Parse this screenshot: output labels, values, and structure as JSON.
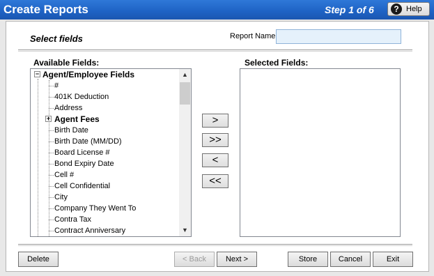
{
  "window": {
    "title": "Create Reports",
    "step": "Step 1 of 6",
    "help_label": "Help",
    "help_icon": "?"
  },
  "section": {
    "title": "Select fields",
    "report_name_label": "Report Name:",
    "report_name_value": ""
  },
  "available": {
    "label": "Available Fields:",
    "items": [
      {
        "text": "Agent/Employee Fields",
        "type": "group",
        "expanded": true
      },
      {
        "text": "#",
        "type": "leaf"
      },
      {
        "text": "401K Deduction",
        "type": "leaf"
      },
      {
        "text": "Address",
        "type": "leaf"
      },
      {
        "text": "Agent Fees",
        "type": "group",
        "expanded": false
      },
      {
        "text": "Birth Date",
        "type": "leaf"
      },
      {
        "text": "Birth Date (MM/DD)",
        "type": "leaf"
      },
      {
        "text": "Board License #",
        "type": "leaf"
      },
      {
        "text": "Bond Expiry Date",
        "type": "leaf"
      },
      {
        "text": "Cell #",
        "type": "leaf"
      },
      {
        "text": "Cell Confidential",
        "type": "leaf"
      },
      {
        "text": "City",
        "type": "leaf"
      },
      {
        "text": "Company They Went To",
        "type": "leaf"
      },
      {
        "text": "Contra Tax",
        "type": "leaf"
      },
      {
        "text": "Contract Anniversary",
        "type": "leaf"
      }
    ]
  },
  "selected": {
    "label": "Selected Fields:",
    "items": []
  },
  "move_buttons": {
    "add": ">",
    "add_all": ">>",
    "remove": "<",
    "remove_all": "<<"
  },
  "buttons": {
    "delete": "Delete",
    "back": "< Back",
    "next": "Next >",
    "store": "Store",
    "cancel": "Cancel",
    "exit": "Exit"
  }
}
